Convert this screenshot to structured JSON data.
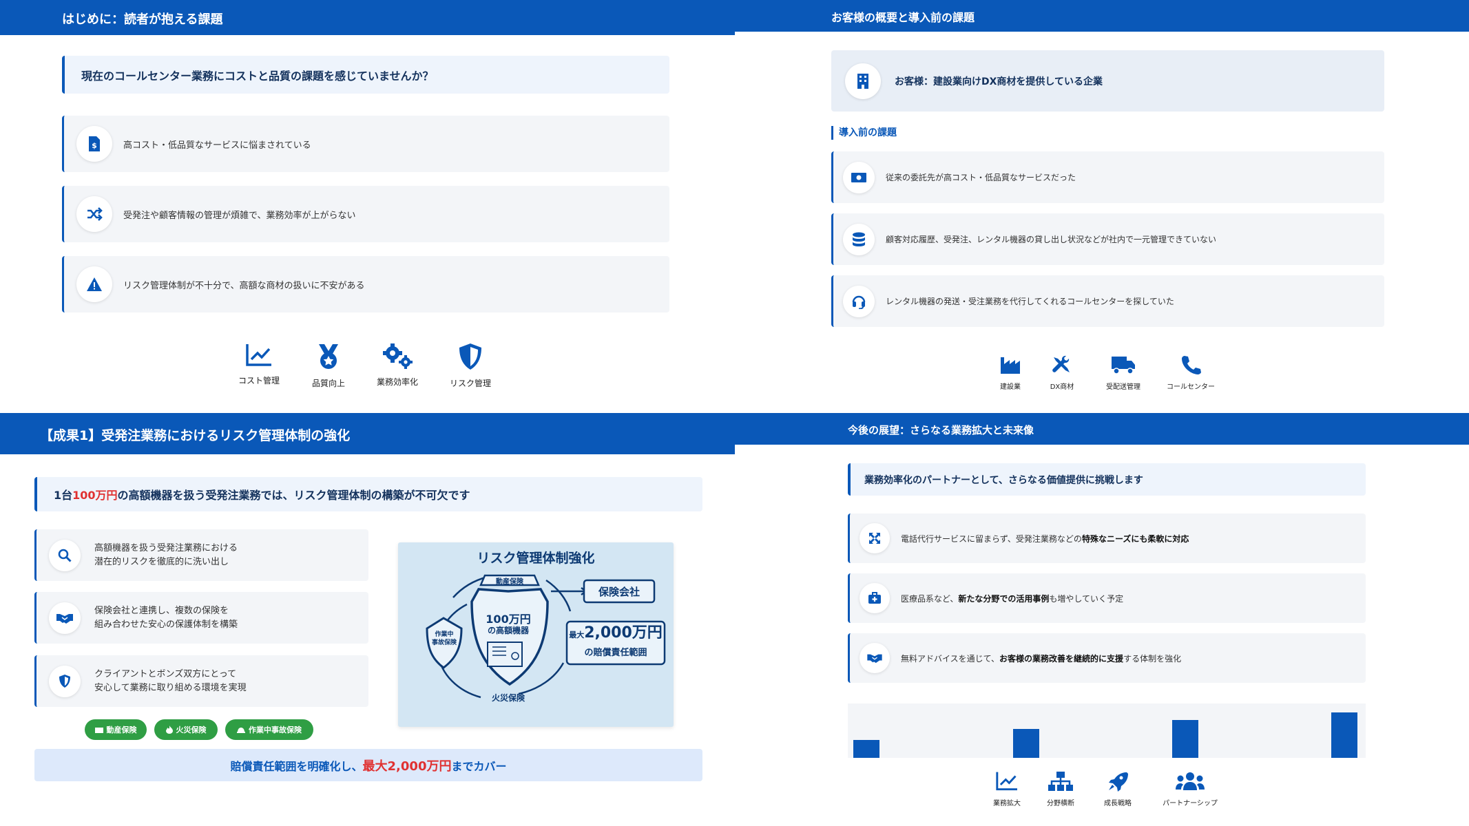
{
  "panel1": {
    "header": "はじめに：読者が抱える課題",
    "question": "現在のコールセンター業務にコストと品質の課題を感じていませんか？",
    "cards": [
      {
        "icon": "invoice-dollar-icon",
        "text": "高コスト・低品質なサービスに悩まされている"
      },
      {
        "icon": "shuffle-icon",
        "text": "受発注や顧客情報の管理が煩雑で、業務効率が上がらない"
      },
      {
        "icon": "warning-icon",
        "text": "リスク管理体制が不十分で、高額な商材の扱いに不安がある"
      }
    ],
    "icons": [
      {
        "icon": "line-chart-icon",
        "label": "コスト管理"
      },
      {
        "icon": "medal-icon",
        "label": "品質向上"
      },
      {
        "icon": "gears-icon",
        "label": "業務効率化"
      },
      {
        "icon": "shield-icon",
        "label": "リスク管理"
      }
    ]
  },
  "panel2": {
    "header": "お客様の概要と導入前の課題",
    "customer": "お客様：建設業向けDX商材を提供している企業",
    "section_title": "導入前の課題",
    "cards": [
      {
        "icon": "money-bill-icon",
        "text": "従来の委託先が高コスト・低品質なサービスだった"
      },
      {
        "icon": "database-icon",
        "text": "顧客対応履歴、受発注、レンタル機器の貸し出し状況などが社内で一元管理できていない"
      },
      {
        "icon": "headset-icon",
        "text": "レンタル機器の発送・受注業務を代行してくれるコールセンターを探していた"
      }
    ],
    "icons": [
      {
        "icon": "industry-icon",
        "label": "建設業"
      },
      {
        "icon": "tools-icon",
        "label": "DX商材"
      },
      {
        "icon": "truck-icon",
        "label": "受配送管理"
      },
      {
        "icon": "phone-icon",
        "label": "コールセンター"
      }
    ]
  },
  "panel3": {
    "header": "【成果1】受発注業務におけるリスク管理体制の強化",
    "lead_pre": "1台",
    "lead_accent": "100万円",
    "lead_post": "の高額機器を扱う受発注業務では、リスク管理体制の構築が不可欠です",
    "cards": [
      {
        "icon": "search-icon",
        "line1": "高額機器を扱う受発注業務における",
        "line2": "潜在的リスクを徹底的に洗い出し"
      },
      {
        "icon": "handshake-icon",
        "line1": "保険会社と連携し、複数の保険を",
        "line2": "組み合わせた安心の保護体制を構築"
      },
      {
        "icon": "shield-icon",
        "line1": "クライアントとボンズ双方にとって",
        "line2": "安心して業務に取り組める環境を実現"
      }
    ],
    "diagram": {
      "title": "リスク管理体制強化",
      "top": "動産保険",
      "left_line1": "作業中",
      "left_line2": "事故保険",
      "bottom": "火災保険",
      "center_line1": "100万円",
      "center_line2": "の高額機器",
      "insurer": "保険会社",
      "limit_prefix": "最大",
      "limit_amount": "2,000万円",
      "limit_line2": "の賠償責任範囲"
    },
    "tags": [
      "動産保険",
      "火災保険",
      "作業中事故保険"
    ],
    "footer_pre": "賠償責任範囲を明確化し、",
    "footer_accent": "最大2,000万円",
    "footer_post": "までカバー",
    "colors": {
      "accent": "#e03131",
      "tag": "#2f9e44",
      "brand": "#0a58b8"
    }
  },
  "panel4": {
    "header": "今後の展望：さらなる業務拡大と未来像",
    "question": "業務効率化のパートナーとして、さらなる価値提供に挑戦します",
    "cards": [
      {
        "icon": "expand-icon",
        "pre": "電話代行サービスに留まらず、受発注業務などの",
        "bold": "特殊なニーズにも柔軟に対応",
        "post": ""
      },
      {
        "icon": "medkit-icon",
        "pre": "医療品系など、",
        "bold": "新たな分野での活用事例",
        "post": "も増やしていく予定"
      },
      {
        "icon": "handshake-icon",
        "pre": "無料アドバイスを通じて、",
        "bold": "お客様の業務改善を継続的に支援",
        "post": "する体制を強化"
      }
    ],
    "growth_bars": [
      0.4,
      0.64,
      0.84,
      1.0
    ],
    "icons": [
      {
        "icon": "line-chart-icon",
        "label": "業務拡大"
      },
      {
        "icon": "sitemap-icon",
        "label": "分野横断"
      },
      {
        "icon": "rocket-icon",
        "label": "成長戦略"
      },
      {
        "icon": "users-icon",
        "label": "パートナーシップ"
      }
    ]
  }
}
